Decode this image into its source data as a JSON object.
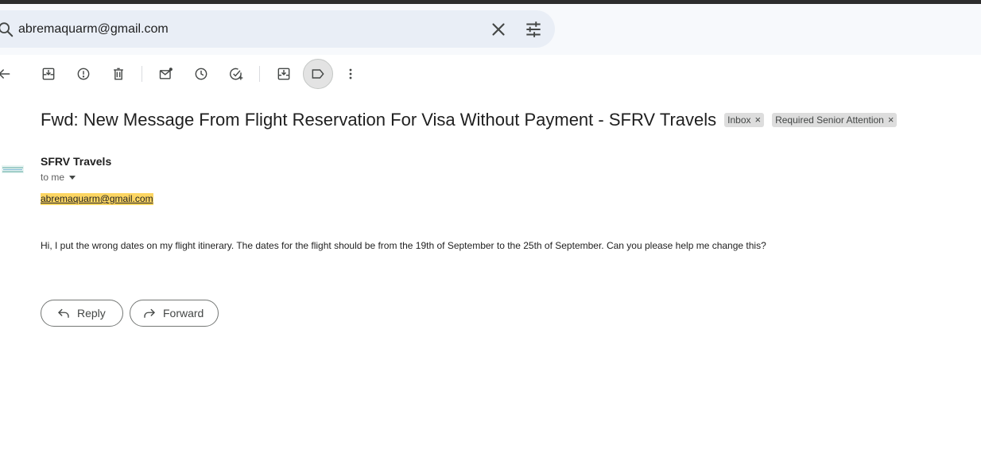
{
  "search": {
    "query": "abremaquarm@gmail.com",
    "icons": {
      "search": "search-icon",
      "clear": "close-icon",
      "options": "tune-icon"
    }
  },
  "toolbar": {
    "buttons": [
      {
        "name": "back",
        "icon": "arrow-back-icon"
      },
      {
        "name": "archive",
        "icon": "archive-icon"
      },
      {
        "name": "report-spam",
        "icon": "report-icon"
      },
      {
        "name": "delete",
        "icon": "trash-icon"
      },
      {
        "name": "mark-unread",
        "icon": "mark-unread-icon"
      },
      {
        "name": "snooze",
        "icon": "clock-icon"
      },
      {
        "name": "add-to-tasks",
        "icon": "add-task-icon"
      },
      {
        "name": "move-to",
        "icon": "move-to-inbox-icon"
      },
      {
        "name": "labels",
        "icon": "label-icon",
        "active": true
      },
      {
        "name": "more",
        "icon": "more-vert-icon"
      }
    ]
  },
  "message": {
    "subject": "Fwd: New Message From Flight Reservation For Visa Without Payment - SFRV Travels",
    "labels": [
      {
        "text": "Inbox",
        "remove": "×"
      },
      {
        "text": "Required Senior Attention",
        "remove": "×"
      }
    ],
    "sender": "SFRV Travels",
    "recipient": "to me",
    "email_link": "abremaquarm@gmail.com",
    "body": "Hi, I put the wrong dates on my flight itinerary. The dates for the flight should be from the 19th of September to the 25th of September. Can you please help me change this?"
  },
  "actions": {
    "reply_label": "Reply",
    "forward_label": "Forward"
  },
  "colors": {
    "header_band": "#f7f9fc",
    "search_bg": "#e9eef6",
    "highlight": "#fdd663",
    "chip_bg": "#dddddd",
    "active_button": "#e3e3e3"
  }
}
